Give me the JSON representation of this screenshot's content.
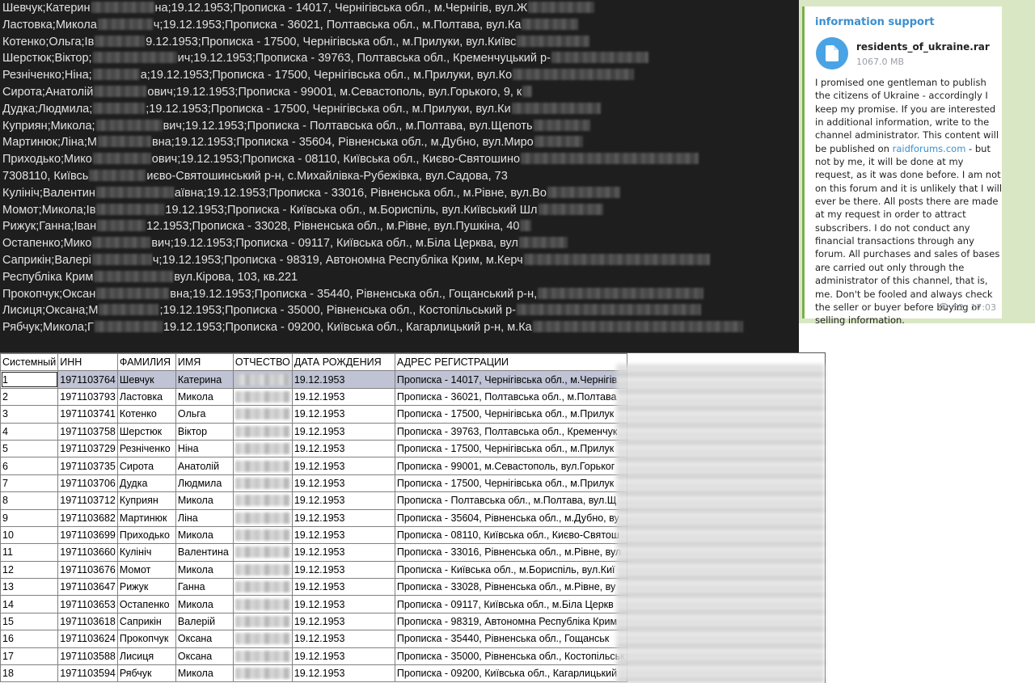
{
  "dump": {
    "lines": [
      {
        "a": "Шевчук;Катерин",
        "b": "на;19.12.1953;Прописка - 14017, Чернігівська обл., м.Чернігів, вул.Ж"
      },
      {
        "a": "Ластовка;Микола",
        "b": "ч;19.12.1953;Прописка - 36021, Полтавська обл., м.Полтава, вул.Ка"
      },
      {
        "a": "Котенко;Ольга;Ів",
        "b": "9.12.1953;Прописка - 17500, Чернігівська обл., м.Прилуки, вул.Київс"
      },
      {
        "a": "Шерстюк;Віктор;",
        "b": "ич;19.12.1953;Прописка - 39763, Полтавська обл., Кременчуцький р-"
      },
      {
        "a": "Резніченко;Ніна;",
        "b": "а;19.12.1953;Прописка - 17500, Чернігівська обл., м.Прилуки, вул.Ко"
      },
      {
        "a": "Сирота;Анатолій",
        "b": "ович;19.12.1953;Прописка - 99001, м.Севастополь, вул.Горького, 9, к"
      },
      {
        "a": "Дудка;Людмила;",
        "b": ";19.12.1953;Прописка - 17500, Чернігівська обл., м.Прилуки, вул.Ки"
      },
      {
        "a": "Куприян;Микола;",
        "b": "вич;19.12.1953;Прописка - Полтавська обл., м.Полтава, вул.Щепоть"
      },
      {
        "a": "Мартинюк;Ліна;М",
        "b": "вна;19.12.1953;Прописка - 35604, Рівненська обл., м.Дубно, вул.Миро"
      },
      {
        "a": "Приходько;Мико",
        "b": "ович;19.12.1953;Прописка - 08110, Київська обл., Києво-Святошино"
      },
      {
        "a": "7308110, Київсь",
        "b": "иєво-Святошинський р-н, с.Михайлівка-Рубежівка, вул.Садова, 73"
      },
      {
        "a": "Кулініч;Валентин",
        "b": "аївна;19.12.1953;Прописка - 33016, Рівненська обл., м.Рівне, вул.Во"
      },
      {
        "a": "Момот;Микола;Ів",
        "b": "19.12.1953;Прописка - Київська обл., м.Бориспіль, вул.Київський Шл"
      },
      {
        "a": "Рижук;Ганна;Іван",
        "b": "12.1953;Прописка - 33028, Рівненська обл., м.Рівне, вул.Пушкіна, 40"
      },
      {
        "a": "Остапенко;Мико",
        "b": "вич;19.12.1953;Прописка - 09117, Київська обл., м.Біла Церква, вул"
      },
      {
        "a": "Саприкін;Валері",
        "b": "ч;19.12.1953;Прописка - 98319, Автономна Республіка Крим, м.Керч"
      },
      {
        "a": "Республіка Крим",
        "b": "вул.Кірова, 103, кв.221"
      },
      {
        "a": "Прокопчук;Оксан",
        "b": "вна;19.12.1953;Прописка - 35440, Рівненська обл., Гощанський р-н,"
      },
      {
        "a": "Лисиця;Оксана;М",
        "b": ";19.12.1953;Прописка - 35000, Рівненська обл., Костопільський р-"
      },
      {
        "a": "Рябчук;Микола;Г",
        "b": "19.12.1953;Прописка - 09200, Київська обл., Кагарлицький р-н, м.Ка"
      }
    ]
  },
  "telegram": {
    "channel": "information support",
    "file_name": "residents_of_ukraine.rar",
    "file_size": "1067.0 MB",
    "text_before_link": "I promised one gentleman to publish the citizens of Ukraine - accordingly I keep my promise. If you are interested in additional information, write to the channel administrator. This content will be published on ",
    "link": "raidforums.com",
    "text_after_link": " - but not by me, it will be done at my request, as it was done before. I am not on this forum and it is unlikely that I will ever be there. All posts there are made at my request in order to attract subscribers. I do not conduct any financial transactions through any forum. All purchases and sales of bases are carried out only through the administrator of this channel, that is, me. Don't be fooled and always check the seller or buyer before buying or selling information.",
    "views": "52",
    "time": "17:03",
    "accent": "#3a8fd0"
  },
  "table": {
    "headers": [
      "Системный",
      "ИНН",
      "ФАМИЛИЯ",
      "ИМЯ",
      "ОТЧЕСТВО",
      "ДАТА РОЖДЕНИЯ",
      "АДРЕС РЕГИСТРАЦИИ"
    ],
    "rows": [
      [
        "1",
        "1971103764",
        "Шевчук",
        "Катерина",
        "19.12.1953",
        "Прописка - 14017, Чернігівська обл., м.Чернігів"
      ],
      [
        "2",
        "1971103793",
        "Ластовка",
        "Микола",
        "19.12.1953",
        "Прописка - 36021, Полтавська обл., м.Полтава"
      ],
      [
        "3",
        "1971103741",
        "Котенко",
        "Ольга",
        "19.12.1953",
        "Прописка - 17500, Чернігівська обл., м.Прилук"
      ],
      [
        "4",
        "1971103758",
        "Шерстюк",
        "Віктор",
        "19.12.1953",
        "Прописка - 39763, Полтавська обл., Кременчук"
      ],
      [
        "5",
        "1971103729",
        "Резніченко",
        "Ніна",
        "19.12.1953",
        "Прописка - 17500, Чернігівська обл., м.Прилук"
      ],
      [
        "6",
        "1971103735",
        "Сирота",
        "Анатолій",
        "19.12.1953",
        "Прописка - 99001, м.Севастополь, вул.Горьког"
      ],
      [
        "7",
        "1971103706",
        "Дудка",
        "Людмила",
        "19.12.1953",
        "Прописка - 17500, Чернігівська обл., м.Прилук"
      ],
      [
        "8",
        "1971103712",
        "Куприян",
        "Микола",
        "19.12.1953",
        "Прописка - Полтавська обл., м.Полтава, вул.Щ"
      ],
      [
        "9",
        "1971103682",
        "Мартинюк",
        "Ліна",
        "19.12.1953",
        "Прописка - 35604, Рівненська обл., м.Дубно, ву"
      ],
      [
        "10",
        "1971103699",
        "Приходько",
        "Микола",
        "19.12.1953",
        "Прописка - 08110, Київська обл., Києво-Святош"
      ],
      [
        "11",
        "1971103660",
        "Кулініч",
        "Валентина",
        "19.12.1953",
        "Прописка - 33016, Рівненська обл., м.Рівне, вул"
      ],
      [
        "12",
        "1971103676",
        "Момот",
        "Микола",
        "19.12.1953",
        "Прописка - Київська обл., м.Бориспіль, вул.Киї"
      ],
      [
        "13",
        "1971103647",
        "Рижук",
        "Ганна",
        "19.12.1953",
        "Прописка - 33028, Рівненська обл., м.Рівне, ву"
      ],
      [
        "14",
        "1971103653",
        "Остапенко",
        "Микола",
        "19.12.1953",
        "Прописка - 09117, Київська обл., м.Біла Церкв"
      ],
      [
        "15",
        "1971103618",
        "Саприкін",
        "Валерій",
        "19.12.1953",
        "Прописка - 98319, Автономна Республіка Крим"
      ],
      [
        "16",
        "1971103624",
        "Прокопчук",
        "Оксана",
        "19.12.1953",
        "Прописка - 35440, Рівненська обл., Гощанськ"
      ],
      [
        "17",
        "1971103588",
        "Лисиця",
        "Оксана",
        "19.12.1953",
        "Прописка - 35000, Рівненська обл., Костопільськ"
      ],
      [
        "18",
        "1971103594",
        "Рябчук",
        "Микола",
        "19.12.1953",
        "Прописка - 09200, Київська обл., Кагарлицький"
      ]
    ]
  }
}
